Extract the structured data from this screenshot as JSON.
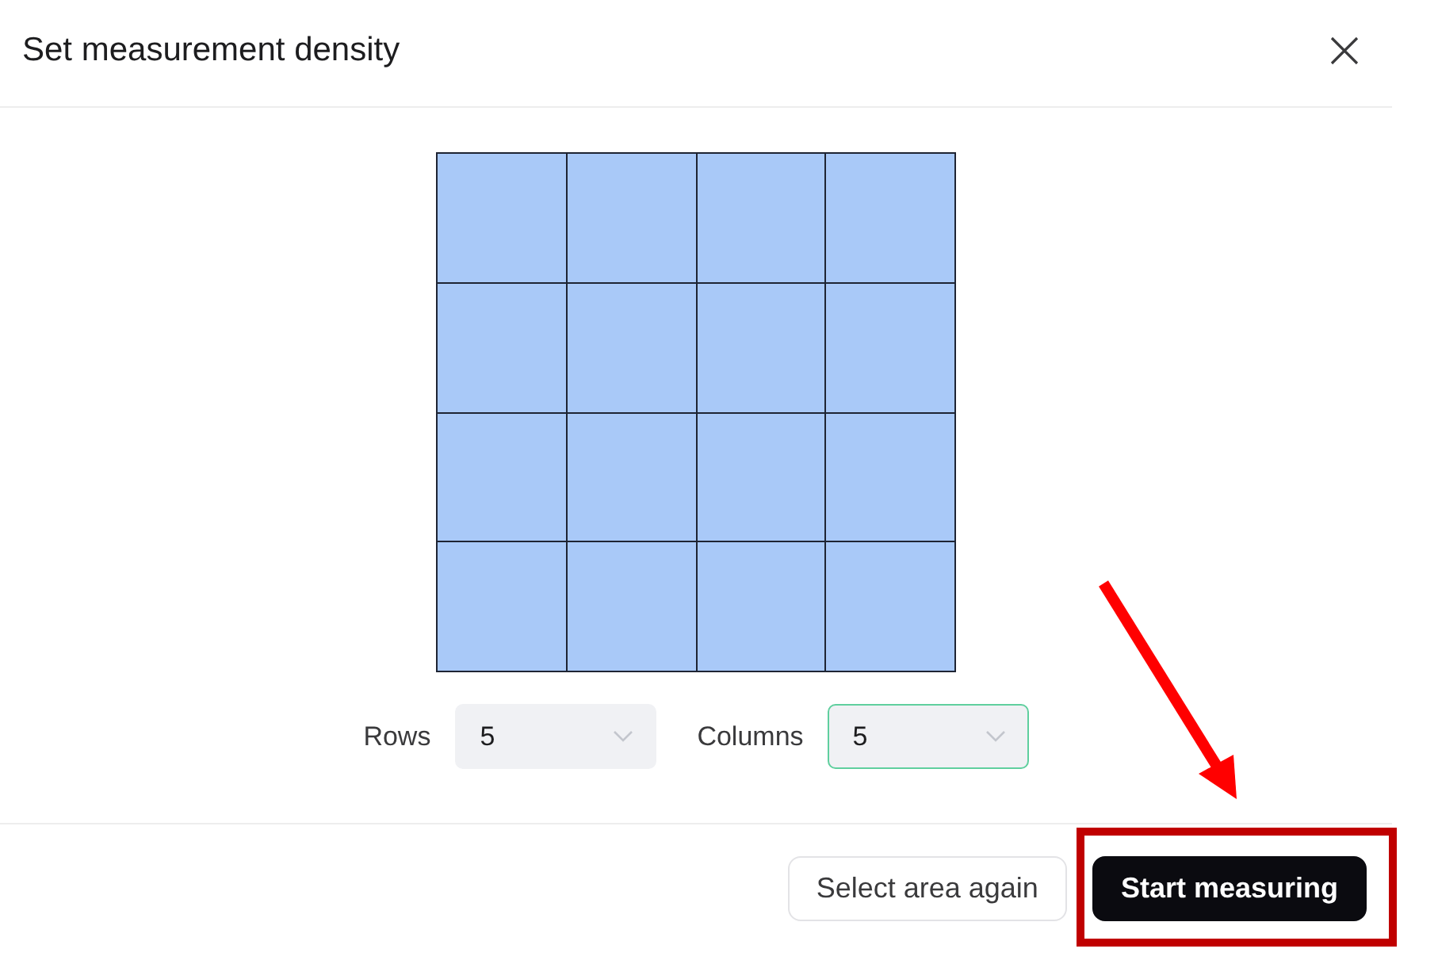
{
  "dialog": {
    "title": "Set measurement density"
  },
  "fields": [
    {
      "label": "Rows",
      "value": "5",
      "focused": false
    },
    {
      "label": "Columns",
      "value": "5",
      "focused": true
    }
  ],
  "buttons": [
    {
      "label": "Select area again",
      "kind": "secondary"
    },
    {
      "label": "Start measuring",
      "kind": "primary"
    }
  ],
  "annotations": [
    {
      "kind": "arrow"
    },
    {
      "kind": "highlight"
    }
  ]
}
